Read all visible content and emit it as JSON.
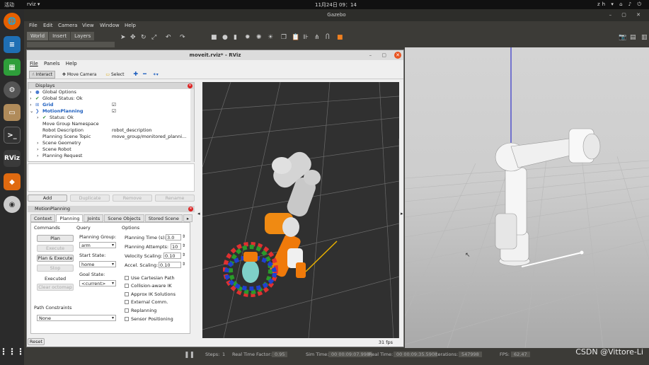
{
  "topbar": {
    "activities": "活动",
    "app": "rviz",
    "clock": "11月24日 09：14",
    "lang": "zh"
  },
  "dock": {
    "items": [
      "firefox-icon",
      "docs-icon",
      "sheet-icon",
      "settings-icon",
      "files-icon",
      "terminal-icon",
      "rviz-icon",
      "layers-icon",
      "dvd-icon",
      "apps-grid-icon"
    ],
    "rviz_label": "RViz"
  },
  "gazebo": {
    "title": "Gazebo",
    "menu": [
      "File",
      "Edit",
      "Camera",
      "View",
      "Window",
      "Help"
    ],
    "tabs": [
      "World",
      "Insert",
      "Layers"
    ],
    "status": {
      "steps_label": "Steps:",
      "steps_value": "1",
      "rtf_label": "Real Time Factor:",
      "rtf_value": "0.95",
      "sim_label": "Sim Time:",
      "sim_value": "00 00:09:07.998",
      "real_label": "Real Time:",
      "real_value": "00 00:09:35.590",
      "iter_label": "Iterations:",
      "iter_value": "547998",
      "fps_label": "FPS:",
      "fps_value": "62.47"
    }
  },
  "rviz": {
    "title": "moveit.rviz* - RViz",
    "menu": [
      "File",
      "Panels",
      "Help"
    ],
    "toolbar": {
      "interact": "Interact",
      "move_camera": "Move Camera",
      "select": "Select"
    },
    "displays": {
      "header": "Displays",
      "rows": [
        {
          "label": "Global Options",
          "value": ""
        },
        {
          "label": "Global Status: Ok",
          "value": ""
        },
        {
          "label": "Grid",
          "value": ""
        },
        {
          "label": "MotionPlanning",
          "value": ""
        },
        {
          "label": "Status: Ok",
          "value": ""
        },
        {
          "label": "Move Group Namespace",
          "value": ""
        },
        {
          "label": "Robot Description",
          "value": "robot_description"
        },
        {
          "label": "Planning Scene Topic",
          "value": "move_group/monitored_planni..."
        },
        {
          "label": "Scene Geometry",
          "value": ""
        },
        {
          "label": "Scene Robot",
          "value": ""
        },
        {
          "label": "Planning Request",
          "value": ""
        }
      ],
      "buttons": {
        "add": "Add",
        "duplicate": "Duplicate",
        "remove": "Remove",
        "rename": "Rename"
      }
    },
    "motion_planning": {
      "header": "MotionPlanning",
      "tabs": [
        "Context",
        "Planning",
        "Joints",
        "Scene Objects",
        "Stored Scene"
      ],
      "commands": {
        "title": "Commands",
        "plan": "Plan",
        "execute": "Execute",
        "plan_execute": "Plan & Execute",
        "stop": "Stop",
        "status": "Executed",
        "clear": "Clear octomap"
      },
      "query": {
        "title": "Query",
        "group_label": "Planning Group:",
        "group_value": "arm",
        "start_label": "Start State:",
        "start_value": "home",
        "goal_label": "Goal State:",
        "goal_value": "<current>"
      },
      "options": {
        "title": "Options",
        "time_label": "Planning Time (s):",
        "time_value": "3.0",
        "attempts_label": "Planning Attempts:",
        "attempts_value": "10",
        "vel_label": "Velocity Scaling:",
        "vel_value": "0.10",
        "acc_label": "Accel. Scaling:",
        "acc_value": "0.10",
        "checks": [
          "Use Cartesian Path",
          "Collision-aware IK",
          "Approx IK Solutions",
          "External Comm.",
          "Replanning",
          "Sensor Positioning"
        ]
      },
      "path_constraints": {
        "label": "Path Constraints",
        "value": "None"
      }
    },
    "reset": "Reset",
    "fps": "31 fps"
  },
  "watermark": "CSDN @Vittore-Li"
}
